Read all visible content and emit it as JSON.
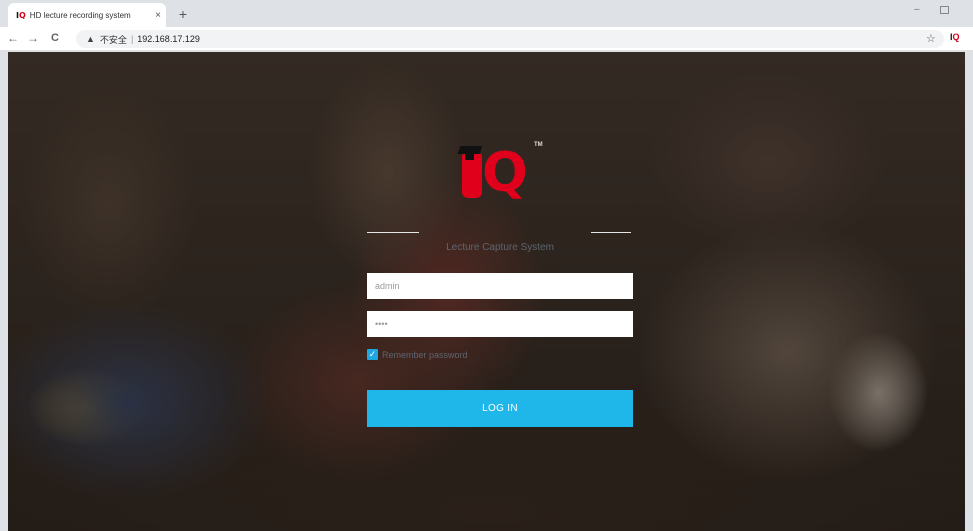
{
  "browser": {
    "tab": {
      "title": "HD lecture recording system",
      "favicon_text": "IQ"
    },
    "controls": {
      "new_tab": "+",
      "close": "×",
      "minimize": "–",
      "back": "←",
      "forward": "→",
      "reload": "C",
      "star": "☆"
    },
    "address": {
      "security_label": "不安全",
      "separator": "|",
      "url": "192.168.17.129"
    },
    "extension_text": "IQ"
  },
  "login": {
    "logo": {
      "text": "Q",
      "trademark": "TM"
    },
    "subtitle": "Lecture Capture System",
    "username": {
      "value": "admin"
    },
    "password": {
      "masked_value": "••••"
    },
    "remember": {
      "label": "Remember password",
      "checked": true
    },
    "submit_label": "LOG IN"
  },
  "colors": {
    "accent": "#1fb6ea",
    "logo_red": "#e0001b",
    "checkbox": "#1ea7e1"
  }
}
